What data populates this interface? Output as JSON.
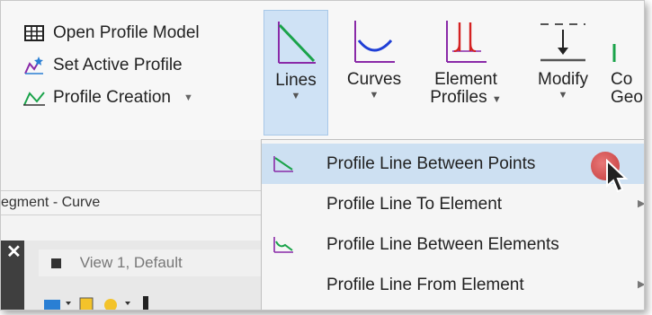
{
  "ribbon": {
    "left_group": [
      {
        "label": "Open Profile Model",
        "icon": "table-grid-icon"
      },
      {
        "label": "Set Active Profile",
        "icon": "profile-star-icon"
      },
      {
        "label": "Profile Creation",
        "icon": "profile-creation-icon",
        "has_dropdown": true
      }
    ],
    "buttons": {
      "lines": {
        "label": "Lines",
        "icon": "lines-icon"
      },
      "curves": {
        "label": "Curves",
        "icon": "curves-icon"
      },
      "element_profiles": {
        "label_line1": "Element",
        "label_line2": "Profiles",
        "icon": "element-profiles-icon"
      },
      "modify": {
        "label": "Modify",
        "icon": "modify-icon"
      },
      "more": {
        "label_line1": "Co",
        "label_line2": "Geo"
      }
    }
  },
  "lower_pane": {
    "tab_text": "egment - Curve",
    "view_title": "View 1, Default"
  },
  "menu": {
    "items": [
      {
        "label": "Profile Line Between Points",
        "icon": "line-between-points-icon",
        "highlighted": true,
        "submenu": false
      },
      {
        "label": "Profile Line To Element",
        "icon": "",
        "highlighted": false,
        "submenu": true
      },
      {
        "label": "Profile Line Between Elements",
        "icon": "line-between-elements-icon",
        "highlighted": false,
        "submenu": false
      },
      {
        "label": "Profile Line From Element",
        "icon": "",
        "highlighted": false,
        "submenu": true
      }
    ]
  },
  "colors": {
    "accent_highlight": "#cde0f2",
    "lines_green": "#1aa34a",
    "curve_blue": "#1f3fd6",
    "element_red": "#d42222",
    "purple": "#8a2aa8"
  }
}
